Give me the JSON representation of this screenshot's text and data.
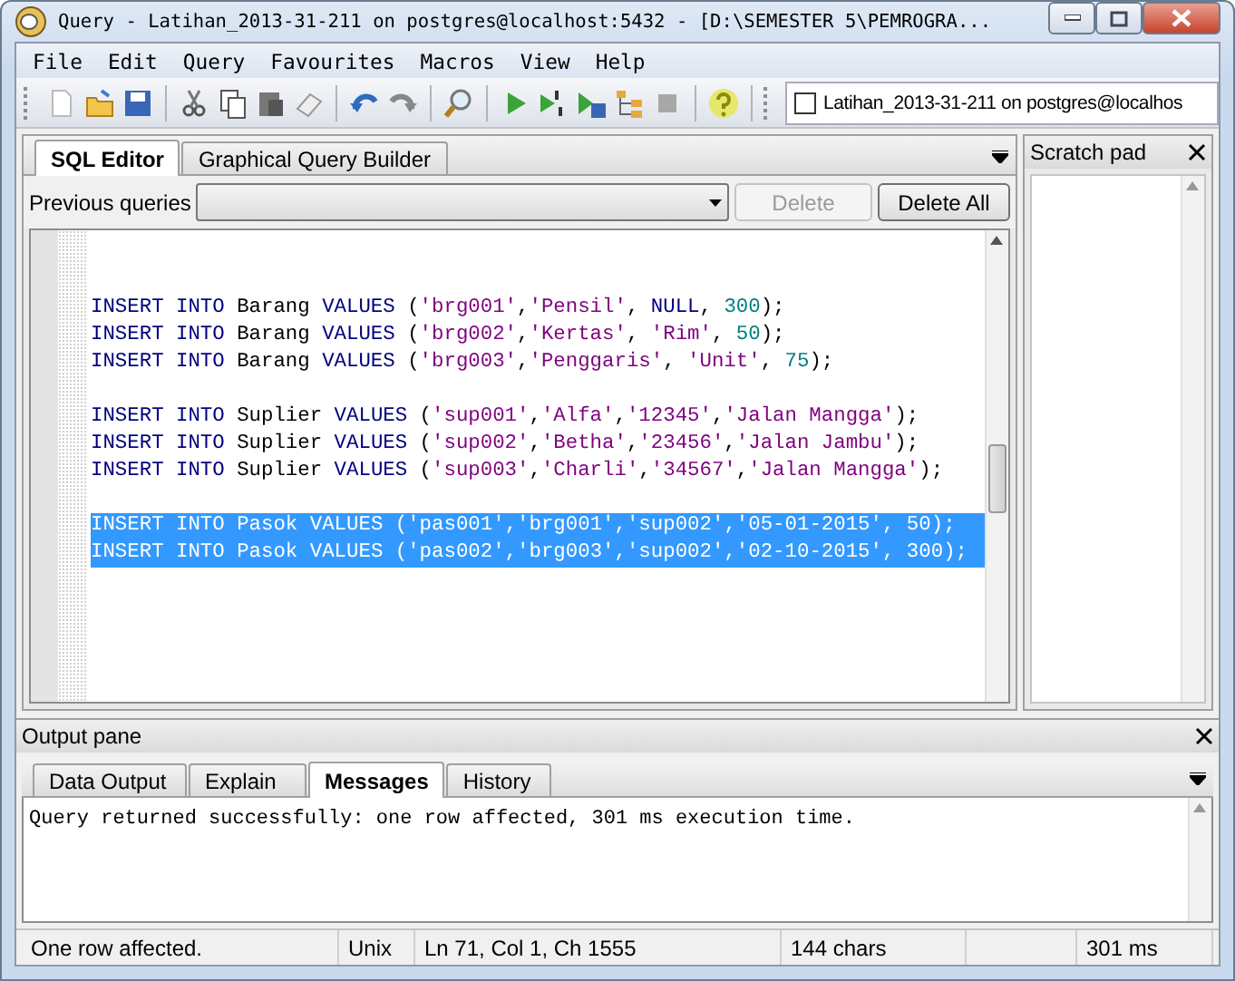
{
  "window": {
    "title": "Query - Latihan_2013-31-211 on postgres@localhost:5432 - [D:\\SEMESTER 5\\PEMROGRA..."
  },
  "menu": [
    "File",
    "Edit",
    "Query",
    "Favourites",
    "Macros",
    "View",
    "Help"
  ],
  "connection": {
    "checked": false,
    "label": "Latihan_2013-31-211 on postgres@localhos"
  },
  "editor_tabs": [
    {
      "label": "SQL Editor",
      "selected": true
    },
    {
      "label": "Graphical Query Builder",
      "selected": false
    }
  ],
  "previous_queries": {
    "label": "Previous queries"
  },
  "query_buttons": [
    {
      "label": "Delete",
      "disabled": true
    },
    {
      "label": "Delete All",
      "disabled": false
    }
  ],
  "editor": {
    "lines": [
      {
        "kind": "blank",
        "selected": false
      },
      {
        "kind": "blank",
        "selected": false
      },
      {
        "kind": "code",
        "selected": false,
        "tokens": [
          {
            "kind": "keyword",
            "text": "INSERT INTO "
          },
          {
            "kind": "ident",
            "text": "Barang "
          },
          {
            "kind": "keyword",
            "text": "VALUES "
          },
          {
            "kind": "punct",
            "text": "("
          },
          {
            "kind": "string",
            "text": "'brg001'"
          },
          {
            "kind": "punct",
            "text": ","
          },
          {
            "kind": "string",
            "text": "'Pensil'"
          },
          {
            "kind": "punct",
            "text": ", "
          },
          {
            "kind": "keyword",
            "text": "NULL"
          },
          {
            "kind": "punct",
            "text": ", "
          },
          {
            "kind": "number",
            "text": "300"
          },
          {
            "kind": "punct",
            "text": ");"
          }
        ]
      },
      {
        "kind": "code",
        "selected": false,
        "tokens": [
          {
            "kind": "keyword",
            "text": "INSERT INTO "
          },
          {
            "kind": "ident",
            "text": "Barang "
          },
          {
            "kind": "keyword",
            "text": "VALUES "
          },
          {
            "kind": "punct",
            "text": "("
          },
          {
            "kind": "string",
            "text": "'brg002'"
          },
          {
            "kind": "punct",
            "text": ","
          },
          {
            "kind": "string",
            "text": "'Kertas'"
          },
          {
            "kind": "punct",
            "text": ", "
          },
          {
            "kind": "string",
            "text": "'Rim'"
          },
          {
            "kind": "punct",
            "text": ", "
          },
          {
            "kind": "number",
            "text": "50"
          },
          {
            "kind": "punct",
            "text": ");"
          }
        ]
      },
      {
        "kind": "code",
        "selected": false,
        "tokens": [
          {
            "kind": "keyword",
            "text": "INSERT INTO "
          },
          {
            "kind": "ident",
            "text": "Barang "
          },
          {
            "kind": "keyword",
            "text": "VALUES "
          },
          {
            "kind": "punct",
            "text": "("
          },
          {
            "kind": "string",
            "text": "'brg003'"
          },
          {
            "kind": "punct",
            "text": ","
          },
          {
            "kind": "string",
            "text": "'Penggaris'"
          },
          {
            "kind": "punct",
            "text": ", "
          },
          {
            "kind": "string",
            "text": "'Unit'"
          },
          {
            "kind": "punct",
            "text": ", "
          },
          {
            "kind": "number",
            "text": "75"
          },
          {
            "kind": "punct",
            "text": ");"
          }
        ]
      },
      {
        "kind": "blank",
        "selected": false
      },
      {
        "kind": "code",
        "selected": false,
        "tokens": [
          {
            "kind": "keyword",
            "text": "INSERT INTO "
          },
          {
            "kind": "ident",
            "text": "Suplier "
          },
          {
            "kind": "keyword",
            "text": "VALUES "
          },
          {
            "kind": "punct",
            "text": "("
          },
          {
            "kind": "string",
            "text": "'sup001'"
          },
          {
            "kind": "punct",
            "text": ","
          },
          {
            "kind": "string",
            "text": "'Alfa'"
          },
          {
            "kind": "punct",
            "text": ","
          },
          {
            "kind": "string",
            "text": "'12345'"
          },
          {
            "kind": "punct",
            "text": ","
          },
          {
            "kind": "string",
            "text": "'Jalan Mangga'"
          },
          {
            "kind": "punct",
            "text": ");"
          }
        ]
      },
      {
        "kind": "code",
        "selected": false,
        "tokens": [
          {
            "kind": "keyword",
            "text": "INSERT INTO "
          },
          {
            "kind": "ident",
            "text": "Suplier "
          },
          {
            "kind": "keyword",
            "text": "VALUES "
          },
          {
            "kind": "punct",
            "text": "("
          },
          {
            "kind": "string",
            "text": "'sup002'"
          },
          {
            "kind": "punct",
            "text": ","
          },
          {
            "kind": "string",
            "text": "'Betha'"
          },
          {
            "kind": "punct",
            "text": ","
          },
          {
            "kind": "string",
            "text": "'23456'"
          },
          {
            "kind": "punct",
            "text": ","
          },
          {
            "kind": "string",
            "text": "'Jalan Jambu'"
          },
          {
            "kind": "punct",
            "text": ");"
          }
        ]
      },
      {
        "kind": "code",
        "selected": false,
        "tokens": [
          {
            "kind": "keyword",
            "text": "INSERT INTO "
          },
          {
            "kind": "ident",
            "text": "Suplier "
          },
          {
            "kind": "keyword",
            "text": "VALUES "
          },
          {
            "kind": "punct",
            "text": "("
          },
          {
            "kind": "string",
            "text": "'sup003'"
          },
          {
            "kind": "punct",
            "text": ","
          },
          {
            "kind": "string",
            "text": "'Charli'"
          },
          {
            "kind": "punct",
            "text": ","
          },
          {
            "kind": "string",
            "text": "'34567'"
          },
          {
            "kind": "punct",
            "text": ","
          },
          {
            "kind": "string",
            "text": "'Jalan Mangga'"
          },
          {
            "kind": "punct",
            "text": ");"
          }
        ]
      },
      {
        "kind": "blank",
        "selected": false
      },
      {
        "kind": "code",
        "selected": true,
        "tokens": [
          {
            "kind": "keyword",
            "text": "INSERT INTO "
          },
          {
            "kind": "ident",
            "text": "Pasok "
          },
          {
            "kind": "keyword",
            "text": "VALUES "
          },
          {
            "kind": "punct",
            "text": "("
          },
          {
            "kind": "string",
            "text": "'pas001'"
          },
          {
            "kind": "punct",
            "text": ","
          },
          {
            "kind": "string",
            "text": "'brg001'"
          },
          {
            "kind": "punct",
            "text": ","
          },
          {
            "kind": "string",
            "text": "'sup002'"
          },
          {
            "kind": "punct",
            "text": ","
          },
          {
            "kind": "string",
            "text": "'05-01-2015'"
          },
          {
            "kind": "punct",
            "text": ", "
          },
          {
            "kind": "number",
            "text": "50"
          },
          {
            "kind": "punct",
            "text": ");"
          }
        ]
      },
      {
        "kind": "code",
        "selected": true,
        "tokens": [
          {
            "kind": "keyword",
            "text": "INSERT INTO "
          },
          {
            "kind": "ident",
            "text": "Pasok "
          },
          {
            "kind": "keyword",
            "text": "VALUES "
          },
          {
            "kind": "punct",
            "text": "("
          },
          {
            "kind": "string",
            "text": "'pas002'"
          },
          {
            "kind": "punct",
            "text": ","
          },
          {
            "kind": "string",
            "text": "'brg003'"
          },
          {
            "kind": "punct",
            "text": ","
          },
          {
            "kind": "string",
            "text": "'sup002'"
          },
          {
            "kind": "punct",
            "text": ","
          },
          {
            "kind": "string",
            "text": "'02-10-2015'"
          },
          {
            "kind": "punct",
            "text": ", "
          },
          {
            "kind": "number",
            "text": "300"
          },
          {
            "kind": "punct",
            "text": ");"
          }
        ]
      }
    ]
  },
  "scratch_pad": {
    "title": "Scratch pad"
  },
  "output_pane": {
    "title": "Output pane",
    "tabs": [
      {
        "label": "Data Output",
        "selected": false
      },
      {
        "label": "Explain",
        "selected": false
      },
      {
        "label": "Messages",
        "selected": true
      },
      {
        "label": "History",
        "selected": false
      }
    ],
    "message": "Query returned successfully: one row affected, 301 ms execution time."
  },
  "status_bar": [
    {
      "kind": "text",
      "text": "One row affected."
    },
    {
      "kind": "text",
      "text": "Unix"
    },
    {
      "kind": "text",
      "text": "Ln 71, Col 1, Ch 1555"
    },
    {
      "kind": "text",
      "text": "144 chars"
    },
    {
      "kind": "spacer"
    },
    {
      "kind": "text",
      "text": "301 ms"
    }
  ]
}
